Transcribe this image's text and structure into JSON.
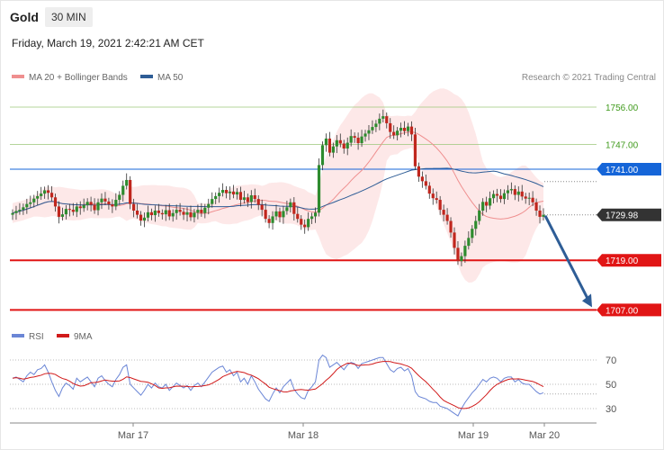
{
  "header": {
    "instrument": "Gold",
    "timeframe": "30 MIN",
    "datetime": "Friday, March 19, 2021 2:42:21 AM CET"
  },
  "legend": {
    "items": [
      {
        "label": "MA 20 + Bollinger Bands",
        "color": "#ef8f8f"
      },
      {
        "label": "MA 50",
        "color": "#2e5d96"
      }
    ],
    "credit": "Research © 2021 Trading Central"
  },
  "chart_data": [
    {
      "type": "candlestick",
      "title": "Gold 30 MIN",
      "x_ticks": [
        "Mar 17",
        "Mar 18",
        "Mar 19",
        "Mar 20"
      ],
      "price_levels": [
        {
          "value": "1756.00",
          "style": "resistance-thin",
          "color": "#3f9a1b"
        },
        {
          "value": "1747.00",
          "style": "resistance-thin",
          "color": "#3f9a1b"
        },
        {
          "value": "1741.00",
          "style": "pivot",
          "color": "#1565d8"
        },
        {
          "value": "1729.98",
          "style": "last-price",
          "color": "#333333"
        },
        {
          "value": "1719.00",
          "style": "support",
          "color": "#e11515"
        },
        {
          "value": "1707.00",
          "style": "support",
          "color": "#e11515"
        }
      ],
      "close_series": [
        1730.4,
        1730.9,
        1731.2,
        1731.8,
        1732.6,
        1733.0,
        1733.9,
        1734.5,
        1735.1,
        1735.9,
        1735.3,
        1734.2,
        1732.0,
        1729.5,
        1730.1,
        1731.4,
        1731.2,
        1730.7,
        1732.0,
        1731.6,
        1732.3,
        1733.1,
        1732.4,
        1731.1,
        1733.0,
        1733.9,
        1733.2,
        1732.5,
        1732.0,
        1733.6,
        1734.8,
        1737.0,
        1738.4,
        1732.6,
        1731.0,
        1730.0,
        1728.6,
        1729.3,
        1730.6,
        1729.9,
        1731.0,
        1730.4,
        1730.1,
        1731.1,
        1729.6,
        1730.4,
        1731.2,
        1730.7,
        1730.0,
        1730.6,
        1729.4,
        1730.5,
        1731.2,
        1730.4,
        1731.7,
        1732.6,
        1733.8,
        1734.5,
        1735.3,
        1736.0,
        1735.2,
        1735.6,
        1734.9,
        1735.5,
        1733.6,
        1734.2,
        1733.1,
        1734.7,
        1733.8,
        1732.4,
        1731.2,
        1729.0,
        1728.0,
        1729.6,
        1730.8,
        1729.4,
        1730.9,
        1731.8,
        1733.0,
        1730.2,
        1729.0,
        1727.6,
        1727.0,
        1729.0,
        1729.6,
        1730.5,
        1742.0,
        1746.8,
        1748.4,
        1745.0,
        1746.5,
        1748.0,
        1747.2,
        1746.0,
        1747.4,
        1749.0,
        1748.6,
        1747.3,
        1748.9,
        1749.6,
        1750.4,
        1751.2,
        1752.0,
        1753.2,
        1753.8,
        1752.1,
        1750.0,
        1749.2,
        1750.3,
        1751.0,
        1750.2,
        1751.3,
        1749.4,
        1741.7,
        1739.2,
        1738.1,
        1737.0,
        1735.1,
        1734.0,
        1733.6,
        1731.2,
        1730.0,
        1728.5,
        1725.7,
        1722.0,
        1718.8,
        1720.0,
        1722.5,
        1724.4,
        1726.6,
        1728.5,
        1731.0,
        1733.1,
        1732.2,
        1734.0,
        1735.0,
        1734.6,
        1733.8,
        1735.2,
        1735.9,
        1736.2,
        1734.8,
        1735.6,
        1734.4,
        1733.9,
        1734.1,
        1733.0,
        1731.0,
        1729.5,
        1729.98
      ],
      "bollinger": {
        "ma20_color": "#ef8f8f",
        "band_fill": "#fde6e6"
      },
      "ma50_color": "#2e5d96",
      "arrow_target": "1707.00"
    },
    {
      "type": "line",
      "title": "RSI",
      "series": [
        {
          "name": "RSI",
          "color": "#6b86d6"
        },
        {
          "name": "9MA",
          "color": "#d11a1a"
        }
      ],
      "y_ticks": [
        "70",
        "50",
        "30"
      ],
      "ylim": [
        20,
        80
      ],
      "rsi_values": [
        55,
        56,
        54,
        52,
        57,
        60,
        58,
        62,
        63,
        66,
        60,
        52,
        45,
        40,
        47,
        51,
        49,
        46,
        55,
        52,
        54,
        56,
        52,
        48,
        55,
        57,
        53,
        50,
        48,
        54,
        58,
        64,
        66,
        50,
        47,
        44,
        41,
        45,
        50,
        47,
        51,
        48,
        47,
        50,
        45,
        48,
        51,
        49,
        47,
        49,
        45,
        49,
        51,
        48,
        52,
        56,
        60,
        62,
        64,
        65,
        60,
        62,
        57,
        60,
        52,
        55,
        50,
        57,
        52,
        46,
        42,
        38,
        36,
        42,
        47,
        43,
        48,
        51,
        54,
        46,
        42,
        39,
        38,
        45,
        48,
        52,
        70,
        74,
        72,
        64,
        66,
        68,
        65,
        62,
        66,
        68,
        67,
        63,
        67,
        68,
        69,
        70,
        71,
        72,
        72,
        67,
        62,
        60,
        63,
        64,
        61,
        63,
        57,
        44,
        40,
        39,
        38,
        36,
        35,
        35,
        32,
        31,
        30,
        28,
        26,
        24,
        30,
        35,
        39,
        43,
        46,
        50,
        54,
        52,
        55,
        56,
        55,
        52,
        55,
        56,
        56,
        52,
        54,
        51,
        50,
        50,
        47,
        44,
        42,
        43
      ]
    }
  ]
}
